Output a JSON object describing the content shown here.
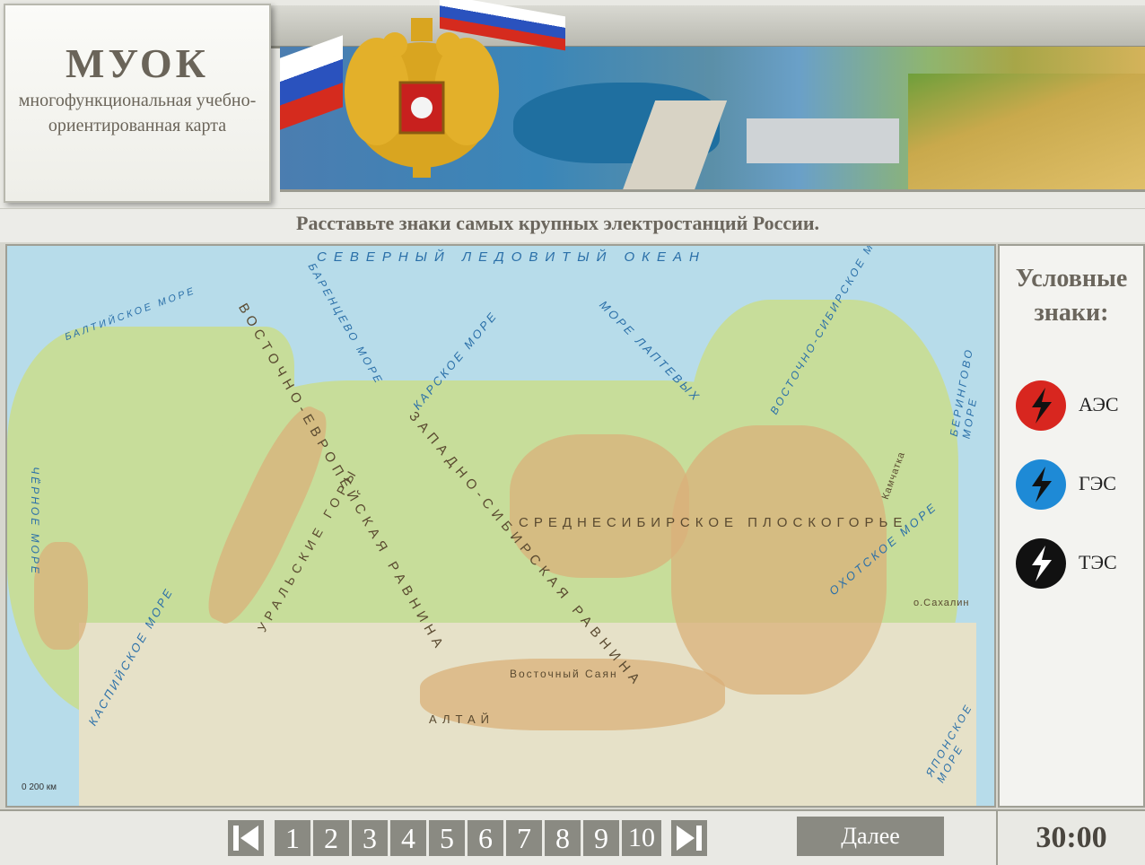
{
  "app": {
    "logo_title": "МУОК",
    "logo_subtitle": "многофункциональная учебно-ориентированная карта"
  },
  "task": {
    "instruction": "Расставьте знаки самых крупных электростанций России."
  },
  "map": {
    "labels": {
      "arctic_ocean": "СЕВЕРНЫЙ ЛЕДОВИТЫЙ ОКЕАН",
      "kara_sea": "КАРСКОЕ МОРЕ",
      "laptev_sea": "МОРЕ ЛАПТЕВЫХ",
      "barents_sea": "БАРЕНЦЕВО МОРЕ",
      "east_siberian_sea": "ВОСТОЧНО-СИБИРСКОЕ МОРЕ",
      "bering_sea": "БЕРИНГОВО МОРЕ",
      "okhotsk_sea": "ОХОТСКОЕ МОРЕ",
      "japan_sea": "ЯПОНСКОЕ МОРЕ",
      "caspian_sea": "КАСПИЙСКОЕ МОРЕ",
      "black_sea": "ЧЁРНОЕ МОРЕ",
      "baltic_sea": "БАЛТИЙСКОЕ МОРЕ",
      "east_european_plain": "ВОСТОЧНО-ЕВРОПЕЙСКАЯ РАВНИНА",
      "ural_mountains": "УРАЛЬСКИЕ ГОРЫ",
      "west_siberian_plain": "ЗАПАДНО-СИБИРСКАЯ РАВНИНА",
      "central_siberian_plateau": "СРЕДНЕСИБИРСКОЕ ПЛОСКОГОРЬЕ",
      "kamchatka": "Камчатка",
      "sakhalin": "о.Сахалин",
      "altai": "АЛТАЙ",
      "sayan": "Восточный Саян",
      "scale": "0   200 км"
    }
  },
  "legend": {
    "title": "Условные знаки:",
    "items": [
      {
        "label": "АЭС",
        "color": "#d8261f",
        "icon": "lightning-icon"
      },
      {
        "label": "ГЭС",
        "color": "#1e8ad6",
        "icon": "lightning-icon"
      },
      {
        "label": "ТЭС",
        "color": "#111111",
        "icon": "lightning-icon"
      }
    ]
  },
  "nav": {
    "pages": [
      "1",
      "2",
      "3",
      "4",
      "5",
      "6",
      "7",
      "8",
      "9",
      "10"
    ],
    "next_label": "Далее",
    "timer": "30:00"
  }
}
